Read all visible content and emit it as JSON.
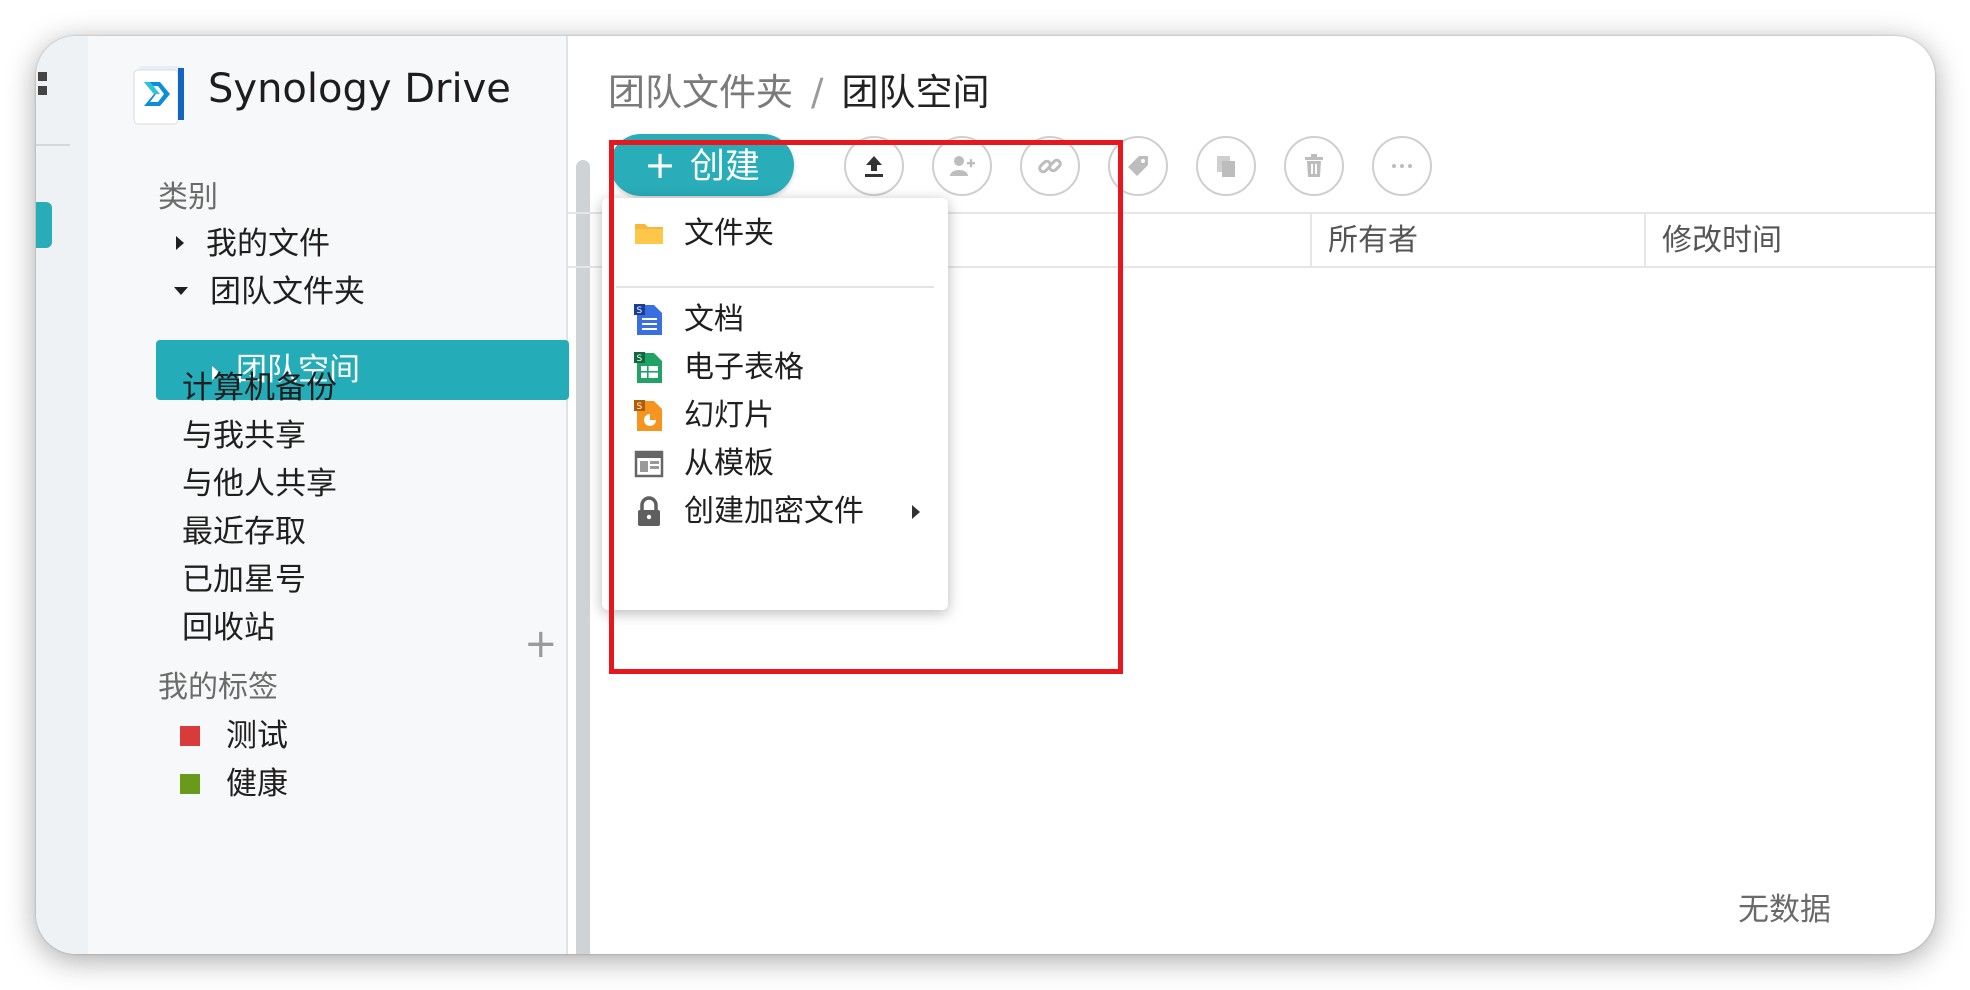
{
  "app": {
    "name": "Synology Drive"
  },
  "sidebar": {
    "category_title": "类别",
    "items": [
      {
        "label": "我的文件"
      },
      {
        "label": "团队文件夹"
      },
      {
        "label": "团队空间"
      },
      {
        "label": "计算机备份"
      },
      {
        "label": "与我共享"
      },
      {
        "label": "与他人共享"
      },
      {
        "label": "最近存取"
      },
      {
        "label": "已加星号"
      },
      {
        "label": "回收站"
      }
    ],
    "tags_title": "我的标签",
    "add_tag_symbol": "+",
    "tags": [
      {
        "label": "测试",
        "color": "#d93a3a"
      },
      {
        "label": "健康",
        "color": "#6a9a1c"
      }
    ]
  },
  "breadcrumb": {
    "parent": "团队文件夹",
    "separator": "/",
    "current": "团队空间"
  },
  "toolbar": {
    "create_label": "创建",
    "create_plus": "+",
    "icons": [
      "upload-icon",
      "add-user-icon",
      "link-icon",
      "tag-icon",
      "copy-icon",
      "delete-icon",
      "more-icon"
    ]
  },
  "table": {
    "columns": [
      "所有者",
      "修改时间"
    ],
    "empty_text": "无数据"
  },
  "create_menu": {
    "items": [
      {
        "label": "文件夹",
        "icon": "folder-icon"
      },
      {
        "label": "文档",
        "icon": "document-icon"
      },
      {
        "label": "电子表格",
        "icon": "spreadsheet-icon"
      },
      {
        "label": "幻灯片",
        "icon": "slides-icon"
      },
      {
        "label": "从模板",
        "icon": "template-icon"
      },
      {
        "label": "创建加密文件",
        "icon": "lock-icon"
      }
    ]
  },
  "colors": {
    "accent": "#28adb9",
    "highlight": "#e8161d"
  }
}
